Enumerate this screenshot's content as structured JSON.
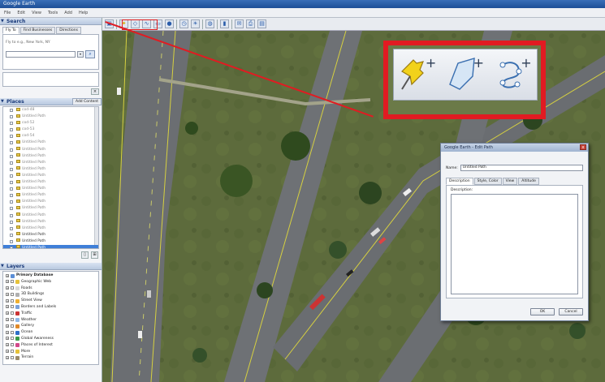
{
  "window": {
    "title": "Google Earth"
  },
  "menu": [
    "File",
    "Edit",
    "View",
    "Tools",
    "Add",
    "Help"
  ],
  "search": {
    "header": "Search",
    "tabs": [
      "Fly To",
      "Find Businesses",
      "Directions"
    ],
    "hint": "Fly to e.g., New York, NY"
  },
  "places": {
    "header": "Places",
    "add_content": "Add Content",
    "items": [
      {
        "label": "cod-48",
        "state": "grey"
      },
      {
        "label": "Untitled Path",
        "state": "grey"
      },
      {
        "label": "cod-52",
        "state": "grey"
      },
      {
        "label": "cod-53",
        "state": "grey"
      },
      {
        "label": "cod-54",
        "state": "grey"
      },
      {
        "label": "Untitled Path",
        "state": "grey"
      },
      {
        "label": "Untitled Path",
        "state": "grey"
      },
      {
        "label": "Untitled Path",
        "state": "grey"
      },
      {
        "label": "Untitled Path",
        "state": "grey"
      },
      {
        "label": "Untitled Path",
        "state": "grey"
      },
      {
        "label": "Untitled Path",
        "state": "grey"
      },
      {
        "label": "Untitled Path",
        "state": "grey"
      },
      {
        "label": "Untitled Path",
        "state": "grey"
      },
      {
        "label": "Untitled Path",
        "state": "grey"
      },
      {
        "label": "Untitled Path",
        "state": "grey"
      },
      {
        "label": "Untitled Path",
        "state": "grey"
      },
      {
        "label": "Untitled Path",
        "state": "grey"
      },
      {
        "label": "Untitled Path",
        "state": "grey"
      },
      {
        "label": "Untitled Path",
        "state": "grey"
      },
      {
        "label": "Untitled Path",
        "state": "normal"
      },
      {
        "label": "Untitled Path",
        "state": "normal"
      },
      {
        "label": "Untitled Path",
        "state": "selected"
      }
    ]
  },
  "layers": {
    "header": "Layers",
    "items": [
      {
        "label": "Primary Database",
        "icon_color": "#5b8ed6",
        "root": true
      },
      {
        "label": "Geographic Web",
        "icon_color": "#e6c23a"
      },
      {
        "label": "Roads",
        "icon_color": "#d9d9d9"
      },
      {
        "label": "3D Buildings",
        "icon_color": "#b0b0b0"
      },
      {
        "label": "Street View",
        "icon_color": "#f0b030"
      },
      {
        "label": "Borders and Labels",
        "icon_color": "#7aa0d8"
      },
      {
        "label": "Traffic",
        "icon_color": "#cc3333"
      },
      {
        "label": "Weather",
        "icon_color": "#8fb8e8"
      },
      {
        "label": "Gallery",
        "icon_color": "#e08a2a"
      },
      {
        "label": "Ocean",
        "icon_color": "#2e6fc8"
      },
      {
        "label": "Global Awareness",
        "icon_color": "#3a9a48"
      },
      {
        "label": "Places of Interest",
        "icon_color": "#d24a8a"
      },
      {
        "label": "More",
        "icon_color": "#e6c23a"
      },
      {
        "label": "Terrain",
        "icon_color": "#9a8a6a"
      }
    ]
  },
  "toolbar": {
    "highlighted": [
      "Add Placemark",
      "Add Polygon",
      "Add Path"
    ]
  },
  "zoom_inset": {
    "buttons": [
      {
        "name": "add-placemark",
        "icon": "pushpin-icon",
        "plus": "+"
      },
      {
        "name": "add-polygon",
        "icon": "polygon-icon",
        "plus": "+"
      },
      {
        "name": "add-path",
        "icon": "path-icon",
        "plus": "+"
      }
    ],
    "accent": "#e11b22"
  },
  "dialog": {
    "title": "Google Earth - Edit Path",
    "close": "x",
    "name_label": "Name:",
    "name_value": "Untitled Path",
    "tabs": [
      "Description",
      "Style, Color",
      "View",
      "Altitude"
    ],
    "description_label": "Description:",
    "ok": "OK",
    "cancel": "Cancel"
  }
}
